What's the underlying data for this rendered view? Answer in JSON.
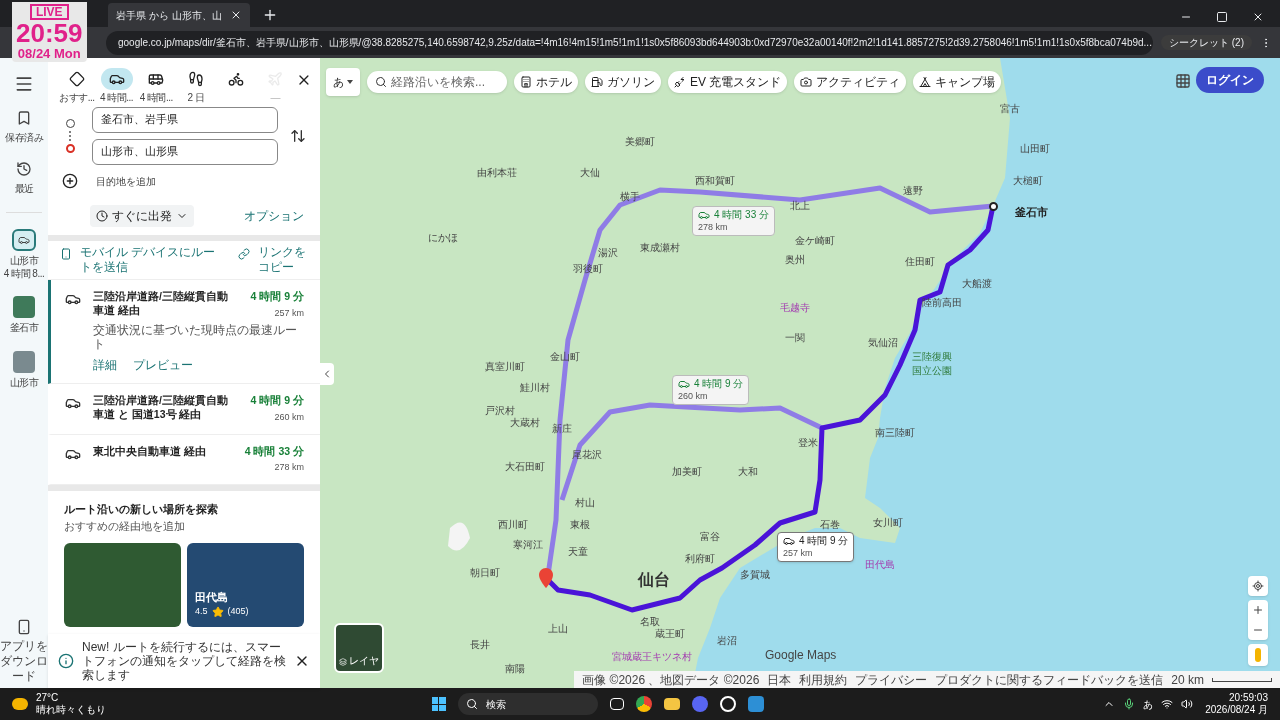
{
  "overlay": {
    "badge": "LIVE",
    "time": "20:59",
    "date": "08/24 Mon"
  },
  "browser": {
    "tab_title": "岩手県 から 山形市、山",
    "url": "google.co.jp/maps/dir/釜石市、岩手県/山形市、山形県/@38.8285275,140.6598742,9.25z/data=!4m16!4m15!1m5!1m1!1s0x5f86093bd644903b:0xd72970e32a00140f!2m2!1d141.8857275!2d39.2758046!1m5!1m1!1s0x5f8bca074b9d...",
    "profile": "シークレット (2)"
  },
  "rail": {
    "items": [
      {
        "kind": "saved",
        "label": "保存済み"
      },
      {
        "kind": "recent",
        "label": "最近"
      }
    ],
    "recent": [
      {
        "kind": "route",
        "label": "山形市",
        "sub": "4 時間 8..."
      },
      {
        "kind": "photo",
        "label": "釜石市"
      },
      {
        "kind": "photo",
        "label": "山形市"
      }
    ],
    "download": "アプリをダウンロード"
  },
  "modes": [
    {
      "kind": "best",
      "label": "おすす...",
      "selected": false,
      "disabled": false
    },
    {
      "kind": "car",
      "label": "4 時間...",
      "selected": true,
      "disabled": false
    },
    {
      "kind": "transit",
      "label": "4 時間...",
      "selected": false,
      "disabled": false
    },
    {
      "kind": "walk",
      "label": "2 日",
      "selected": false,
      "disabled": false
    },
    {
      "kind": "bike",
      "selected": false,
      "disabled": false
    },
    {
      "kind": "plane",
      "label": "—",
      "selected": false,
      "disabled": true
    }
  ],
  "origin": "釜石市、岩手県",
  "destination": "山形市、山形県",
  "add_destination": "目的地を追加",
  "depart": "すぐに出発",
  "options": "オプション",
  "send_to_mobile": "モバイル デバイスにルートを送信",
  "copy_link": "リンクをコピー",
  "routes": [
    {
      "name": "三陸沿岸道路/三陸縦貫自動車道 経由",
      "time": "4 時間 9 分",
      "distance": "257 km",
      "note": "交通状況に基づいた現時点の最速ルート",
      "links": [
        "詳細",
        "プレビュー"
      ],
      "selected": true
    },
    {
      "name": "三陸沿岸道路/三陸縦貫自動車道 と 国道13号 経由",
      "time": "4 時間 9 分",
      "distance": "260 km",
      "selected": false
    },
    {
      "name": "東北中央自動車道 経由",
      "time": "4 時間 33 分",
      "distance": "278 km",
      "selected": false
    }
  ],
  "explore": {
    "title": "ルート沿いの新しい場所を探索",
    "subtitle": "おすすめの経由地を追加",
    "cards": [
      {
        "kind": "forest"
      },
      {
        "kind": "sea",
        "name": "田代島",
        "rating": "4.5",
        "reviews": "(405)"
      }
    ]
  },
  "notice": "New! ルートを続行するには、スマートフォンの通知をタップして経路を検索します",
  "map": {
    "ime": "あ",
    "search_placeholder": "経路沿いを検索...",
    "chips": [
      {
        "kind": "hotel",
        "label": "ホテル"
      },
      {
        "kind": "gas",
        "label": "ガソリン"
      },
      {
        "kind": "ev",
        "label": "EV 充電スタンド"
      },
      {
        "kind": "camera",
        "label": "アクティビティ"
      },
      {
        "kind": "camp",
        "label": "キャンプ場"
      }
    ],
    "login": "ログイン",
    "bubbles": [
      {
        "time": "4 時間 33 分",
        "distance": "278 km",
        "selected": false
      },
      {
        "time": "4 時間 9 分",
        "distance": "260 km",
        "selected": false
      },
      {
        "time": "4 時間 9 分",
        "distance": "257 km",
        "selected": true
      }
    ],
    "labels": [
      {
        "kind": "town",
        "text": "宮古"
      },
      {
        "kind": "town",
        "text": "美郷町"
      },
      {
        "kind": "town",
        "text": "山田町"
      },
      {
        "kind": "town",
        "text": "由利本荘"
      },
      {
        "kind": "town",
        "text": "大仙"
      },
      {
        "kind": "town",
        "text": "大槌町"
      },
      {
        "kind": "town",
        "text": "遠野"
      },
      {
        "kind": "town",
        "text": "横手"
      },
      {
        "kind": "town",
        "text": "西和賀町"
      },
      {
        "kind": "town",
        "text": "北上"
      },
      {
        "kind": "city",
        "text": "釜石市"
      },
      {
        "kind": "town",
        "text": "にかほ"
      },
      {
        "kind": "town",
        "text": "金ケ崎町"
      },
      {
        "kind": "town",
        "text": "東成瀬村"
      },
      {
        "kind": "town",
        "text": "湯沢"
      },
      {
        "kind": "town",
        "text": "奥州"
      },
      {
        "kind": "town",
        "text": "住田町"
      },
      {
        "kind": "town",
        "text": "羽後町"
      },
      {
        "kind": "town",
        "text": "大船渡"
      },
      {
        "kind": "town",
        "text": "陸前高田"
      },
      {
        "kind": "poi",
        "text": "毛越寺"
      },
      {
        "kind": "town",
        "text": "一関"
      },
      {
        "kind": "town",
        "text": "気仙沼"
      },
      {
        "kind": "town",
        "text": "金山町"
      },
      {
        "kind": "park",
        "text": "三陸復興"
      },
      {
        "kind": "town",
        "text": "真室川町"
      },
      {
        "kind": "park",
        "text": "国立公園"
      },
      {
        "kind": "town",
        "text": "鮭川村"
      },
      {
        "kind": "town",
        "text": "戸沢村"
      },
      {
        "kind": "town",
        "text": "大蔵村"
      },
      {
        "kind": "town",
        "text": "新庄"
      },
      {
        "kind": "town",
        "text": "登米"
      },
      {
        "kind": "town",
        "text": "南三陸町"
      },
      {
        "kind": "town",
        "text": "尾花沢"
      },
      {
        "kind": "town",
        "text": "大石田町"
      },
      {
        "kind": "town",
        "text": "加美町"
      },
      {
        "kind": "town",
        "text": "大和"
      },
      {
        "kind": "town",
        "text": "村山"
      },
      {
        "kind": "town",
        "text": "西川町"
      },
      {
        "kind": "town",
        "text": "東根"
      },
      {
        "kind": "town",
        "text": "石巻"
      },
      {
        "kind": "town",
        "text": "女川町"
      },
      {
        "kind": "town",
        "text": "富谷"
      },
      {
        "kind": "town",
        "text": "寒河江"
      },
      {
        "kind": "town",
        "text": "天童"
      },
      {
        "kind": "town",
        "text": "利府町"
      },
      {
        "kind": "poi",
        "text": "田代島"
      },
      {
        "kind": "town",
        "text": "朝日町"
      },
      {
        "kind": "big",
        "text": "仙台"
      },
      {
        "kind": "town",
        "text": "多賀城"
      },
      {
        "kind": "town",
        "text": "名取"
      },
      {
        "kind": "town",
        "text": "上山"
      },
      {
        "kind": "town",
        "text": "蔵王町"
      },
      {
        "kind": "town",
        "text": "岩沼"
      },
      {
        "kind": "town",
        "text": "長井"
      },
      {
        "kind": "poi",
        "text": "宮城蔵王キツネ村"
      },
      {
        "kind": "town",
        "text": "南陽"
      }
    ],
    "layers": "レイヤ",
    "logo": "Google Maps",
    "attribution": [
      "画像 ©2026 、地図データ ©2026",
      "日本",
      "利用規約",
      "プライバシー",
      "プロダクトに関するフィードバックを送信"
    ],
    "scale": "20 km"
  },
  "taskbar": {
    "temp": "27°C",
    "weather": "晴れ時々くもり",
    "search": "検索",
    "time": "20:59:03",
    "date": "2026/08/24 月",
    "ime": "あ"
  }
}
